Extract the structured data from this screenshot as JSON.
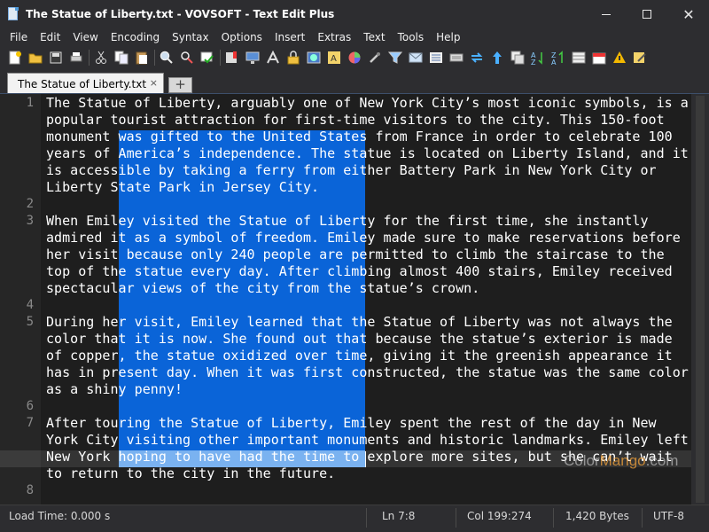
{
  "window": {
    "title": "The Statue of Liberty.txt - VOVSOFT - Text Edit Plus",
    "minimize_glyph": "",
    "maximize_glyph": "",
    "close_glyph": "✕"
  },
  "menu": [
    "File",
    "Edit",
    "View",
    "Encoding",
    "Syntax",
    "Options",
    "Insert",
    "Extras",
    "Text",
    "Tools",
    "Help"
  ],
  "toolbar": {
    "icons": [
      "new-file-icon",
      "open-folder-icon",
      "save-icon",
      "print-icon",
      "cut-icon",
      "copy-icon",
      "paste-icon",
      "find-icon",
      "find-replace-icon",
      "spell-check-icon",
      "bookmark-icon",
      "monitor-icon",
      "font-icon",
      "lock-icon",
      "web-icon",
      "ascii-icon",
      "color-picker-icon",
      "eyedropper-icon",
      "filter-icon",
      "email-icon",
      "list-icon",
      "keyboard-icon",
      "swap-icon",
      "sort-icon",
      "case-icon",
      "sort-az-icon",
      "sort-za-icon",
      "table-icon",
      "calendar-icon",
      "warning-icon",
      "edit-icon"
    ]
  },
  "tabs": {
    "active_label": "The Statue of Liberty.txt",
    "close_glyph": "×",
    "add_glyph": "+"
  },
  "editor": {
    "gutter_numbers": [
      "1",
      "2",
      "3",
      "4",
      "5",
      "6",
      "7",
      "8"
    ],
    "lines": [
      "The Statue of Liberty, arguably one of New York City’s most iconic symbols, is a",
      "popular tourist attraction for first-time visitors to the city. This 150-foot",
      "monument was gifted to the United States from France in order to celebrate 100",
      "years of America’s independence. The statue is located on Liberty Island, and it",
      "is accessible by taking a ferry from either Battery Park in New York City or",
      "Liberty State Park in Jersey City.",
      "",
      "When Emiley visited the Statue of Liberty for the first time, she instantly",
      "admired it as a symbol of freedom. Emiley made sure to make reservations before",
      "her visit because only 240 people are permitted to climb the staircase to the",
      "top of the statue every day. After climbing almost 400 stairs, Emiley received",
      "spectacular views of the city from the statue’s crown.",
      "",
      "During her visit, Emiley learned that the Statue of Liberty was not always the",
      "color that it is now. She found out that because the statue’s exterior is made",
      "of copper, the statue oxidized over time, giving it the greenish appearance it",
      "has in present day. When it was first constructed, the statue was the same color",
      "as a shiny penny!",
      "",
      "After touring the Statue of Liberty, Emiley spent the rest of the day in New",
      "York City visiting other important monuments and historic landmarks. Emiley left",
      "New York hoping to have had the time to explore more sites, but she can’t wait",
      "to return to the city in the future.",
      ""
    ]
  },
  "watermark": {
    "part1": "Color",
    "part2": "Mango",
    "part3": ".com"
  },
  "status": {
    "load_time": "Load Time: 0.000 s",
    "position": "Ln 7:8",
    "column": "Col 199:274",
    "size": "1,420 Bytes",
    "encoding": "UTF-8"
  }
}
